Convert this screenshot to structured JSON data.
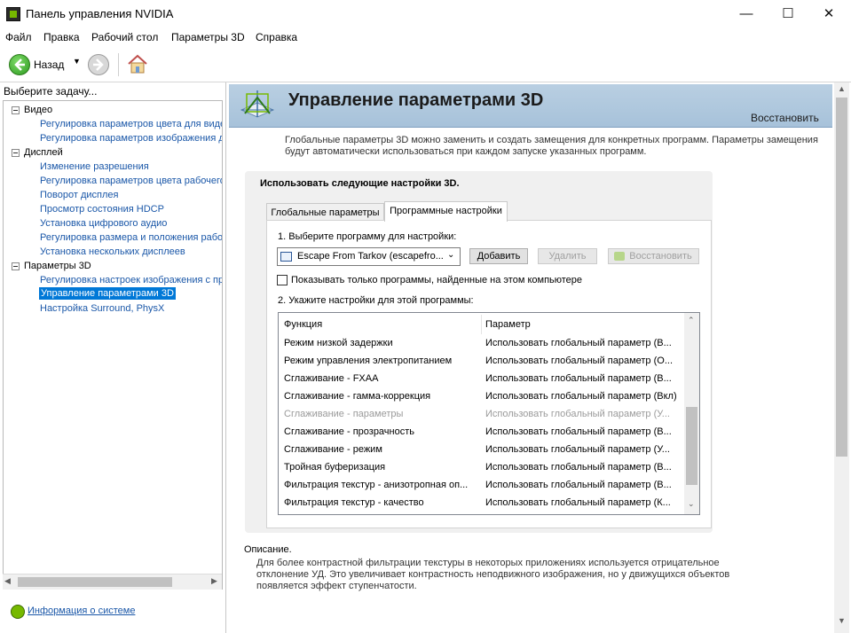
{
  "window": {
    "title": "Панель управления NVIDIA",
    "minimize": "—",
    "maximize": "☐",
    "close": "✕"
  },
  "menu": [
    "Файл",
    "Правка",
    "Рабочий стол",
    "Параметры 3D",
    "Справка"
  ],
  "toolbar": {
    "back_label": "Назад"
  },
  "sidebar": {
    "prompt": "Выберите задачу...",
    "groups": [
      {
        "label": "Видео",
        "items": [
          "Регулировка параметров цвета для видео",
          "Регулировка параметров изображения для видео"
        ]
      },
      {
        "label": "Дисплей",
        "items": [
          "Изменение разрешения",
          "Регулировка параметров цвета рабочего стола",
          "Поворот дисплея",
          "Просмотр состояния HDCP",
          "Установка цифрового аудио",
          "Регулировка размера и положения рабочего стола",
          "Установка нескольких дисплеев"
        ]
      },
      {
        "label": "Параметры 3D",
        "items": [
          "Регулировка настроек изображения с просмотром",
          "Управление параметрами 3D",
          "Настройка Surround, PhysX"
        ]
      }
    ],
    "selected": "Управление параметрами 3D",
    "system_info": "Информация о системе"
  },
  "main": {
    "title": "Управление параметрами 3D",
    "restore_link": "Восстановить",
    "intro": "Глобальные параметры 3D можно заменить и создать замещения для конкретных программ. Параметры замещения будут автоматически использоваться при каждом запуске указанных программ.",
    "group_title": "Использовать следующие настройки 3D.",
    "tabs": [
      "Глобальные параметры",
      "Программные настройки"
    ],
    "active_tab": "Программные настройки",
    "step1": "1. Выберите программу для настройки:",
    "program_select": "Escape From Tarkov (escapefro...",
    "add_btn": "Добавить",
    "remove_btn": "Удалить",
    "restore_btn": "Восстановить",
    "show_only_checkbox": "Показывать только программы, найденные на этом компьютере",
    "step2": "2. Укажите настройки для этой программы:",
    "columns": [
      "Функция",
      "Параметр"
    ],
    "rows": [
      {
        "f": "Режим низкой задержки",
        "v": "Использовать глобальный параметр (В...",
        "disabled": false
      },
      {
        "f": "Режим управления электропитанием",
        "v": "Использовать глобальный параметр (О...",
        "disabled": false
      },
      {
        "f": "Сглаживание - FXAA",
        "v": "Использовать глобальный параметр (В...",
        "disabled": false
      },
      {
        "f": "Сглаживание - гамма-коррекция",
        "v": "Использовать глобальный параметр (Вкл)",
        "disabled": false
      },
      {
        "f": "Сглаживание - параметры",
        "v": "Использовать глобальный параметр (У...",
        "disabled": true
      },
      {
        "f": "Сглаживание - прозрачность",
        "v": "Использовать глобальный параметр (В...",
        "disabled": false
      },
      {
        "f": "Сглаживание - режим",
        "v": "Использовать глобальный параметр (У...",
        "disabled": false
      },
      {
        "f": "Тройная буферизация",
        "v": "Использовать глобальный параметр (В...",
        "disabled": false
      },
      {
        "f": "Фильтрация текстур - анизотропная оп...",
        "v": "Использовать глобальный параметр (В...",
        "disabled": false
      },
      {
        "f": "Фильтрация текстур - качество",
        "v": "Использовать глобальный параметр (К...",
        "disabled": false
      }
    ],
    "description_label": "Описание.",
    "description": "Для более контрастной фильтрации текстуры в некоторых приложениях используется отрицательное отклонение УД. Это увеличивает контрастность неподвижного изображения, но у движущихся объектов появляется эффект ступенчатости."
  },
  "colors": {
    "link": "#1a57a8",
    "header": "#b0c9df",
    "selection": "#0078d7",
    "nvidia_green": "#76b900"
  }
}
